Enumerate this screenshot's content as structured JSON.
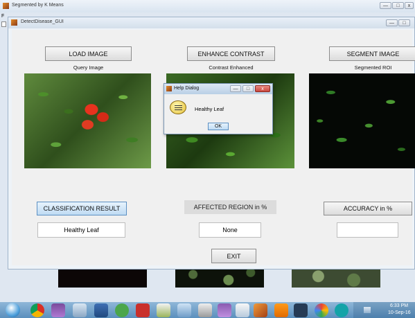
{
  "outer_window": {
    "title": "Segmented by K Means",
    "menu_fragment": "F"
  },
  "gui_window": {
    "title": "DetectDisease_GUI"
  },
  "buttons": {
    "load_image": "LOAD IMAGE",
    "enhance_contrast": "ENHANCE CONTRAST",
    "segment_image": "SEGMENT IMAGE",
    "classification_result": "CLASSIFICATION RESULT",
    "accuracy": "ACCURACY in %",
    "exit": "EXIT"
  },
  "labels": {
    "query_image": "Query Image",
    "contrast_enhanced": "Contrast Enhanced",
    "segmented_roi": "Segmented ROI",
    "affected_region": "AFFECTED REGION in %"
  },
  "fields": {
    "classification_value": "Healthy Leaf",
    "affected_region_value": "None",
    "accuracy_value": ""
  },
  "help_dialog": {
    "title": "Help Dialog",
    "message": "Healthy Leaf",
    "ok_label": "OK"
  },
  "window_buttons": {
    "minimize": "—",
    "maximize": "□",
    "close": "x"
  },
  "taskbar": {
    "clock_time": "6:33 PM",
    "clock_date": "10-Sep-16",
    "icons": [
      "start-orb",
      "chrome",
      "winrar",
      "recycle",
      "app",
      "utorrent",
      "acrobat",
      "sketch",
      "stack",
      "calc",
      "winrar2",
      "notes",
      "matlab",
      "vlc",
      "p-app",
      "picasa",
      "arduino"
    ]
  },
  "colors": {
    "accent_close": "#c9463d",
    "taskbar_bg": "#6a9fc8",
    "dialog_border": "#8fb4d9"
  }
}
